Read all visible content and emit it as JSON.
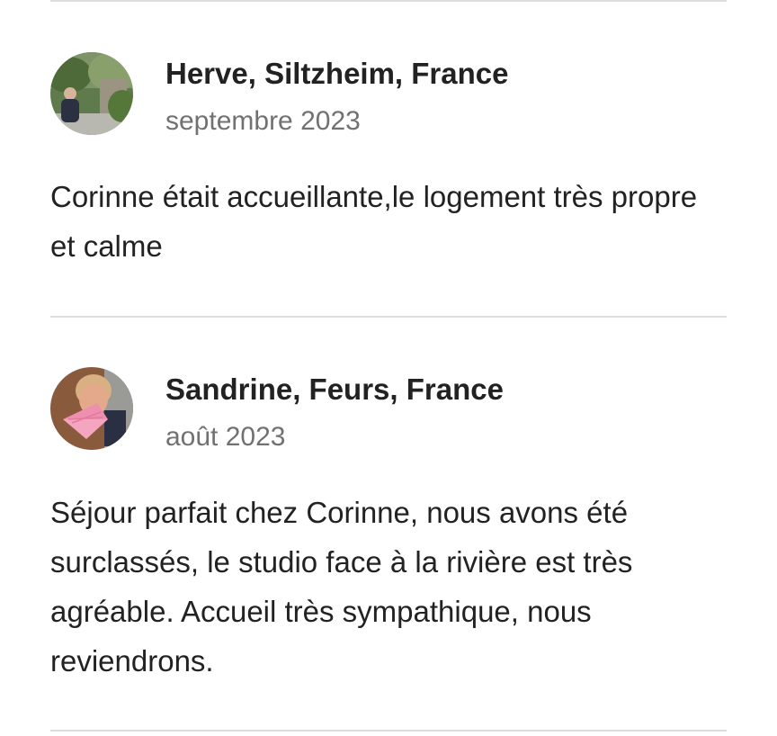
{
  "reviews": [
    {
      "author": "Herve, Siltzheim, France",
      "date": "septembre 2023",
      "text": "Corinne était accueillante,le logement très propre et calme",
      "avatar_icon": "user-photo-outdoor-icon"
    },
    {
      "author": "Sandrine, Feurs, France",
      "date": "août 2023",
      "text": "Séjour parfait chez Corinne, nous avons été surclassés, le studio face à la rivière est très agréable. Accueil très sympathique, nous reviendrons.",
      "avatar_icon": "user-photo-fan-icon"
    }
  ],
  "colors": {
    "text_primary": "#222222",
    "text_secondary": "#717171",
    "divider": "#dddddd"
  }
}
